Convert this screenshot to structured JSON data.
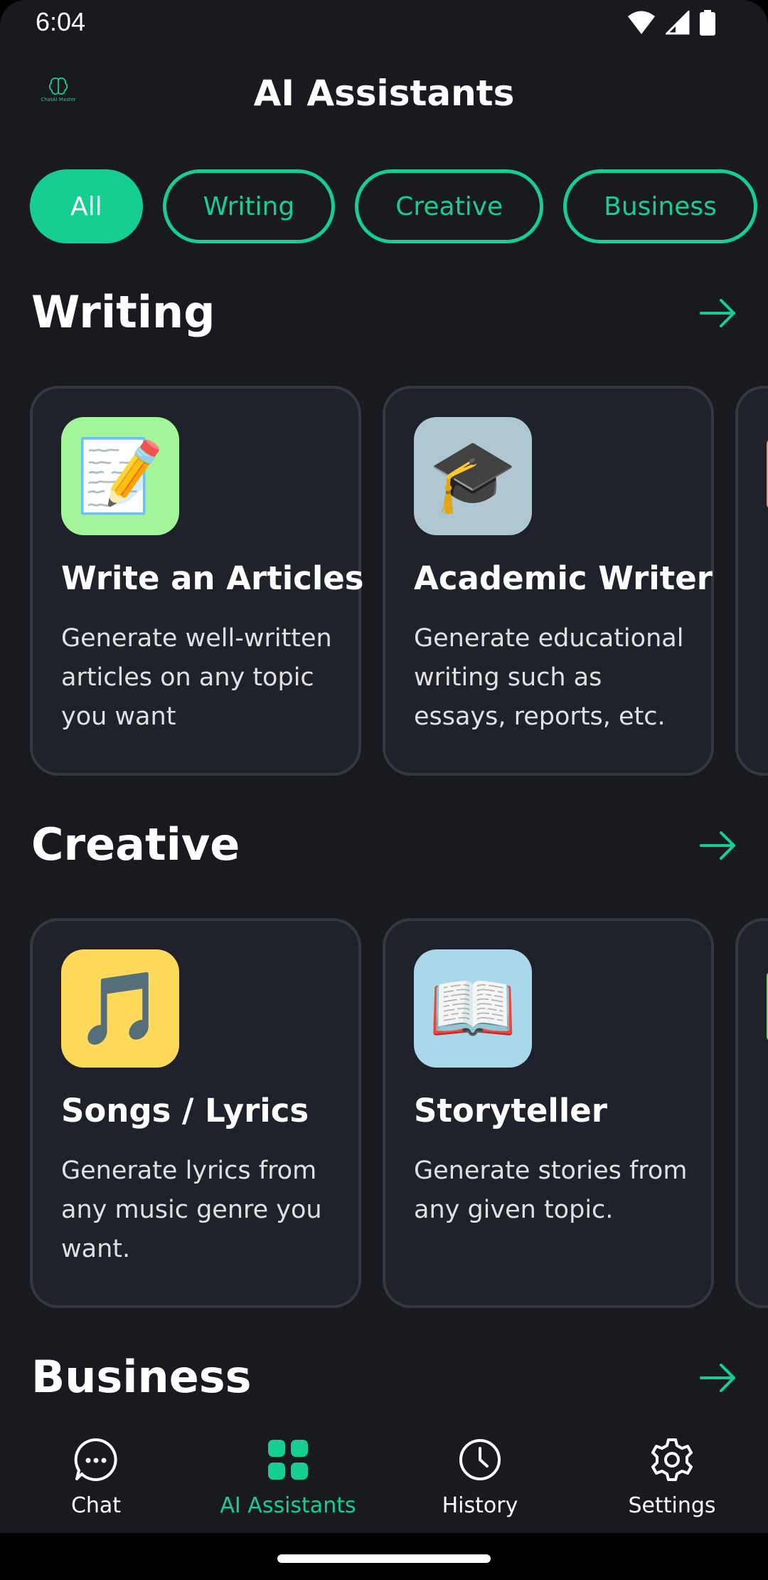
{
  "status_bar": {
    "time": "6:04"
  },
  "header": {
    "logo_text": "ChatAI Master",
    "title": "AI Assistants"
  },
  "filters": [
    {
      "label": "All",
      "active": true
    },
    {
      "label": "Writing",
      "active": false
    },
    {
      "label": "Creative",
      "active": false
    },
    {
      "label": "Business",
      "active": false
    }
  ],
  "sections": [
    {
      "title": "Writing",
      "cards": [
        {
          "icon": "memo-icon",
          "icon_bg": "#a3f59a",
          "glyph": "📝",
          "title": "Write an Articles",
          "description": "Generate well-written articles on any topic you want"
        },
        {
          "icon": "graduation-cap-icon",
          "icon_bg": "#aec7d3",
          "glyph": "🎓",
          "title": "Academic Writer",
          "description": "Generate educational writing such as essays, reports, etc."
        }
      ]
    },
    {
      "title": "Creative",
      "cards": [
        {
          "icon": "music-notes-icon",
          "icon_bg": "#ffd95a",
          "glyph": "🎵",
          "title": "Songs / Lyrics",
          "description": "Generate lyrics from any music genre you want."
        },
        {
          "icon": "open-book-icon",
          "icon_bg": "#a8d8ea",
          "glyph": "📖",
          "title": "Storyteller",
          "description": "Generate stories from any given topic."
        }
      ]
    },
    {
      "title": "Business"
    }
  ],
  "bottom_nav": [
    {
      "label": "Chat",
      "icon": "chat-bubble-icon",
      "active": false
    },
    {
      "label": "AI Assistants",
      "icon": "grid-icon",
      "active": true
    },
    {
      "label": "History",
      "icon": "clock-icon",
      "active": false
    },
    {
      "label": "Settings",
      "icon": "gear-icon",
      "active": false
    }
  ],
  "colors": {
    "accent": "#17ce92",
    "background": "#181a20",
    "card": "#1f222a",
    "card_border": "#35383f"
  }
}
